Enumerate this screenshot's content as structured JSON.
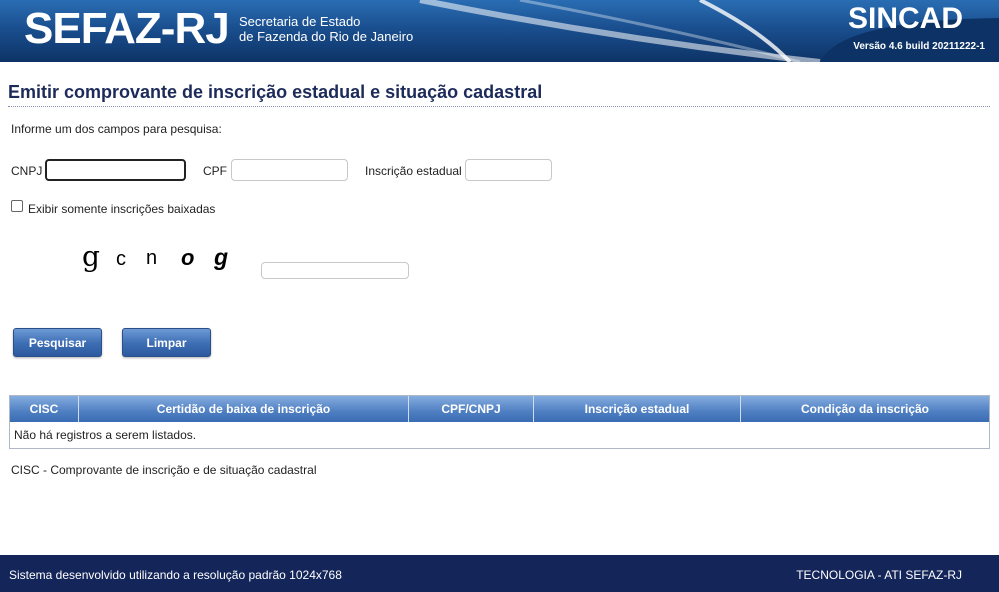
{
  "header": {
    "logo": "SEFAZ-RJ",
    "subtitle_line1": "Secretaria de Estado",
    "subtitle_line2": "de Fazenda do Rio de Janeiro",
    "system": "SINCAD",
    "version": "Versão 4.6 build 20211222-1"
  },
  "page": {
    "title": "Emitir comprovante de inscrição estadual e situação cadastral",
    "instruction": "Informe um dos campos para pesquisa:"
  },
  "form": {
    "cnpj_label": "CNPJ",
    "cnpj_value": "",
    "cpf_label": "CPF",
    "cpf_value": "",
    "ie_label": "Inscrição estadual",
    "ie_value": "",
    "checkbox_label": "Exibir somente inscrições baixadas",
    "checkbox_checked": false,
    "captcha_chars": [
      "g",
      "c",
      "n",
      "o",
      "g"
    ],
    "captcha_value": ""
  },
  "buttons": {
    "search": "Pesquisar",
    "clear": "Limpar"
  },
  "table": {
    "columns": [
      "CISC",
      "Certidão de baixa de inscrição",
      "CPF/CNPJ",
      "Inscrição estadual",
      "Condição da inscrição"
    ],
    "empty_message": "Não há registros a serem listados."
  },
  "legend": "CISC - Comprovante de inscrição e de situação cadastral",
  "footer": {
    "left": "Sistema desenvolvido utilizando a resolução padrão 1024x768",
    "right": "TECNOLOGIA - ATI SEFAZ-RJ"
  }
}
